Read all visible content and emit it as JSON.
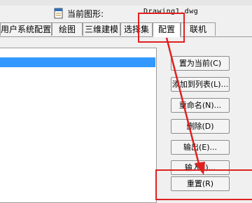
{
  "header": {
    "current_drawing_label": "当前图形:",
    "current_drawing_value": "Drawing1.dwg"
  },
  "tabs": [
    {
      "label": "用户系统配置",
      "active": false
    },
    {
      "label": "绘图",
      "active": false
    },
    {
      "label": "三维建模",
      "active": false
    },
    {
      "label": "选择集",
      "active": false
    },
    {
      "label": "配置",
      "active": true
    },
    {
      "label": "联机",
      "active": false
    }
  ],
  "buttons": {
    "set_current": "置为当前(C)",
    "add_to_list": "添加到列表(L)...",
    "rename": "重命名(N)...",
    "delete": "删除(D)",
    "export": "输出(E)...",
    "import": "输入(I)...",
    "reset": "重置(R)"
  },
  "colors": {
    "annotation_red": "#e02020",
    "selection_blue": "#3399ff"
  }
}
